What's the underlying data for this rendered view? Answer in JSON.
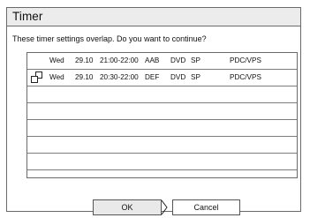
{
  "dialog": {
    "title": "Timer",
    "message": "These timer settings overlap. Do you want to continue?"
  },
  "list": {
    "rows": [
      {
        "day": "Wed",
        "date": "29.10",
        "time": "21:00-22:00",
        "channel": "AAB",
        "media": "DVD",
        "mode": "SP",
        "pdc": "PDC/VPS",
        "icon": ""
      },
      {
        "day": "Wed",
        "date": "29.10",
        "time": "20:30-22:00",
        "channel": "DEF",
        "media": "DVD",
        "mode": "SP",
        "pdc": "PDC/VPS",
        "icon": "overlap-icon"
      }
    ],
    "empty_rows": 5
  },
  "buttons": {
    "ok_label": "OK",
    "cancel_label": "Cancel"
  }
}
